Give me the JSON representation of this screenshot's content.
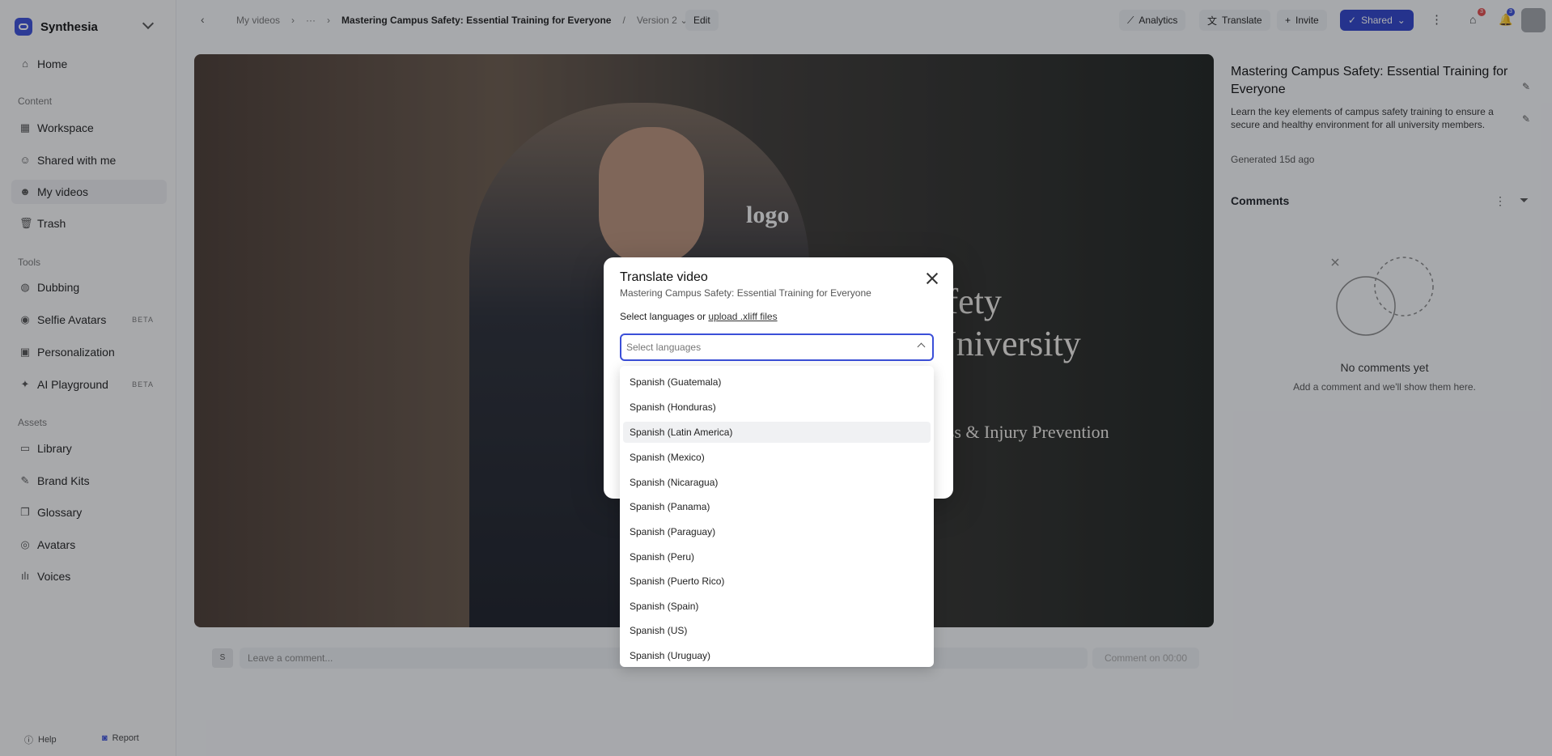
{
  "sidebar": {
    "workspace": "Synthesia",
    "home": "Home",
    "content_label": "Content",
    "content_items": [
      "Workspace",
      "Shared with me",
      "My videos",
      "Trash"
    ],
    "tools_label": "Tools",
    "tools_items": [
      "Dubbing",
      "Selfie Avatars",
      "Personalization",
      "AI Playground"
    ],
    "beta": "BETA",
    "assets_label": "Assets",
    "assets_items": [
      "Library",
      "Brand Kits",
      "Glossary",
      "Avatars",
      "Voices"
    ],
    "help": "Help",
    "report": "Report"
  },
  "topbar": {
    "crumb_myvideos": "My videos",
    "crumb_more": "···",
    "crumb_title": "Mastering Campus Safety: Essential Training for Everyone",
    "crumb_sep": "/",
    "crumb_version": "Version 2",
    "edit": "Edit",
    "analytics": "Analytics",
    "translate": "Translate",
    "invite": "Invite",
    "shared": "Shared",
    "badge_a": "3",
    "badge_b": "3"
  },
  "video": {
    "logo": "logo",
    "title_1": "afety",
    "title_2": "University",
    "subtitle": "ness & Injury Prevention"
  },
  "panel": {
    "title": "Mastering Campus Safety: Essential Training for Everyone",
    "description": "Learn the key elements of campus safety training to ensure a secure and healthy environment for all university members.",
    "generated": "Generated 15d ago",
    "comments": "Comments",
    "no_comments": "No comments yet",
    "hint": "Add a comment and we'll show them here."
  },
  "comment_bar": {
    "avatar": "S",
    "placeholder": "Leave a comment...",
    "button": "Comment on 00:00"
  },
  "modal": {
    "title": "Translate video",
    "subtitle": "Mastering Campus Safety: Essential Training for Everyone",
    "label_prefix": "Select languages or",
    "label_link": "upload .xliff files",
    "select_placeholder": "Select languages",
    "options": [
      "Spanish (Guatemala)",
      "Spanish (Honduras)",
      "Spanish (Latin America)",
      "Spanish (Mexico)",
      "Spanish (Nicaragua)",
      "Spanish (Panama)",
      "Spanish (Paraguay)",
      "Spanish (Peru)",
      "Spanish (Puerto Rico)",
      "Spanish (Spain)",
      "Spanish (US)",
      "Spanish (Uruguay)"
    ],
    "highlighted": "Spanish (Latin America)"
  }
}
